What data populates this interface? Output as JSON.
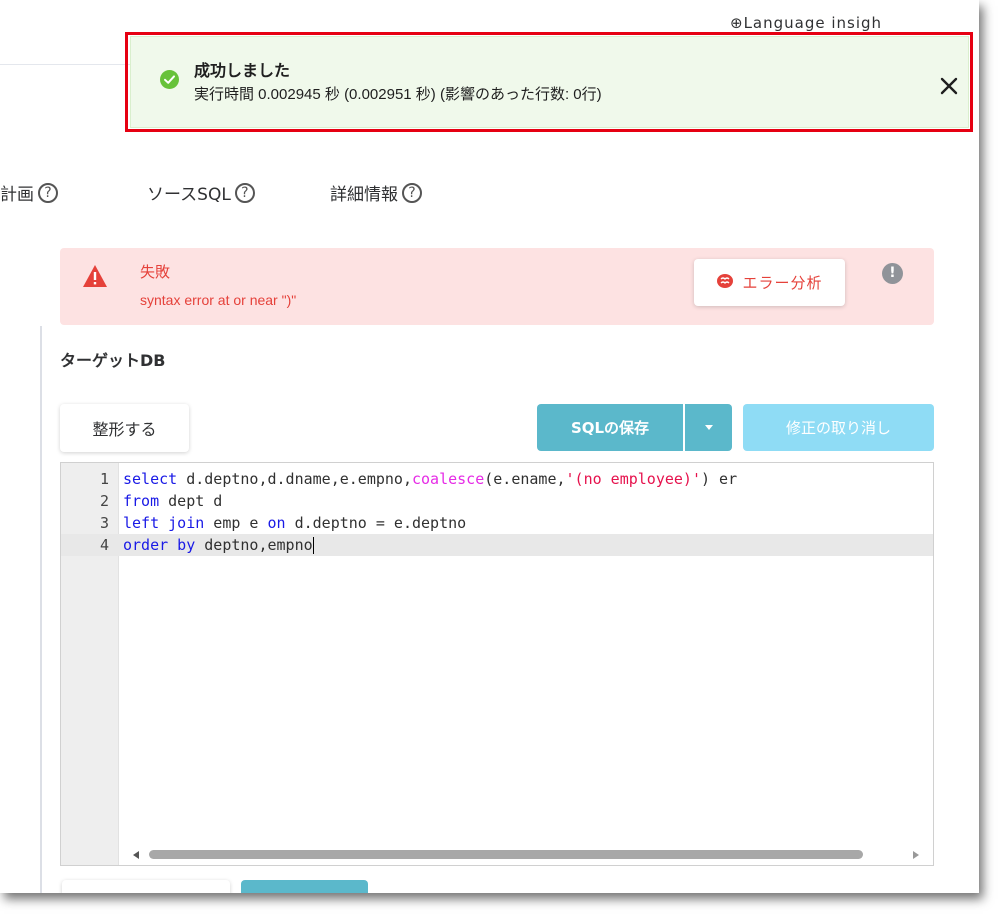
{
  "header": {
    "language_label": "⊕Language  insigh"
  },
  "toast": {
    "status": "success",
    "title": "成功しました",
    "message": "実行時間 0.002945 秒 (0.002951 秒) (影響のあった行数: 0行)",
    "close_icon": "close-icon",
    "color": "#67c23a",
    "background": "#f0f9eb",
    "highlight_color": "#e60012"
  },
  "tabs": [
    {
      "label": "計画",
      "icon": "help-icon"
    },
    {
      "label": "ソースSQL",
      "icon": "help-icon"
    },
    {
      "label": "詳細情報",
      "icon": "help-icon"
    }
  ],
  "alert": {
    "type": "error",
    "title": "失敗",
    "message": "syntax error at or near \")\"",
    "action_label": "エラー分析",
    "action_icon": "brain-icon",
    "info_icon": "info-icon",
    "color": "#e5413a",
    "background": "#fde2e2"
  },
  "target": {
    "label": "ターゲットDB"
  },
  "toolbar": {
    "format_label": "整形する",
    "save_label": "SQLの保存",
    "save_dropdown_icon": "caret-down-icon",
    "undo_label": "修正の取り消し",
    "primary_color": "#5bb8cb",
    "disabled_color": "#8fdcf5"
  },
  "editor": {
    "line_numbers": [
      "1",
      "2",
      "3",
      "4"
    ],
    "active_line": 4,
    "lines": [
      [
        {
          "t": "kw",
          "v": "select"
        },
        {
          "t": "plain",
          "v": " d.deptno,d.dname,e.empno,"
        },
        {
          "t": "fn",
          "v": "coalesce"
        },
        {
          "t": "plain",
          "v": "(e.ename,"
        },
        {
          "t": "str",
          "v": "'(no employee)'"
        },
        {
          "t": "plain",
          "v": ") er"
        }
      ],
      [
        {
          "t": "kw",
          "v": "from"
        },
        {
          "t": "plain",
          "v": " dept d"
        }
      ],
      [
        {
          "t": "kw",
          "v": "left join"
        },
        {
          "t": "plain",
          "v": " emp e "
        },
        {
          "t": "kw",
          "v": "on"
        },
        {
          "t": "plain",
          "v": " d.deptno = e.deptno"
        }
      ],
      [
        {
          "t": "kw",
          "v": "order by"
        },
        {
          "t": "plain",
          "v": " deptno,empno"
        }
      ]
    ]
  }
}
